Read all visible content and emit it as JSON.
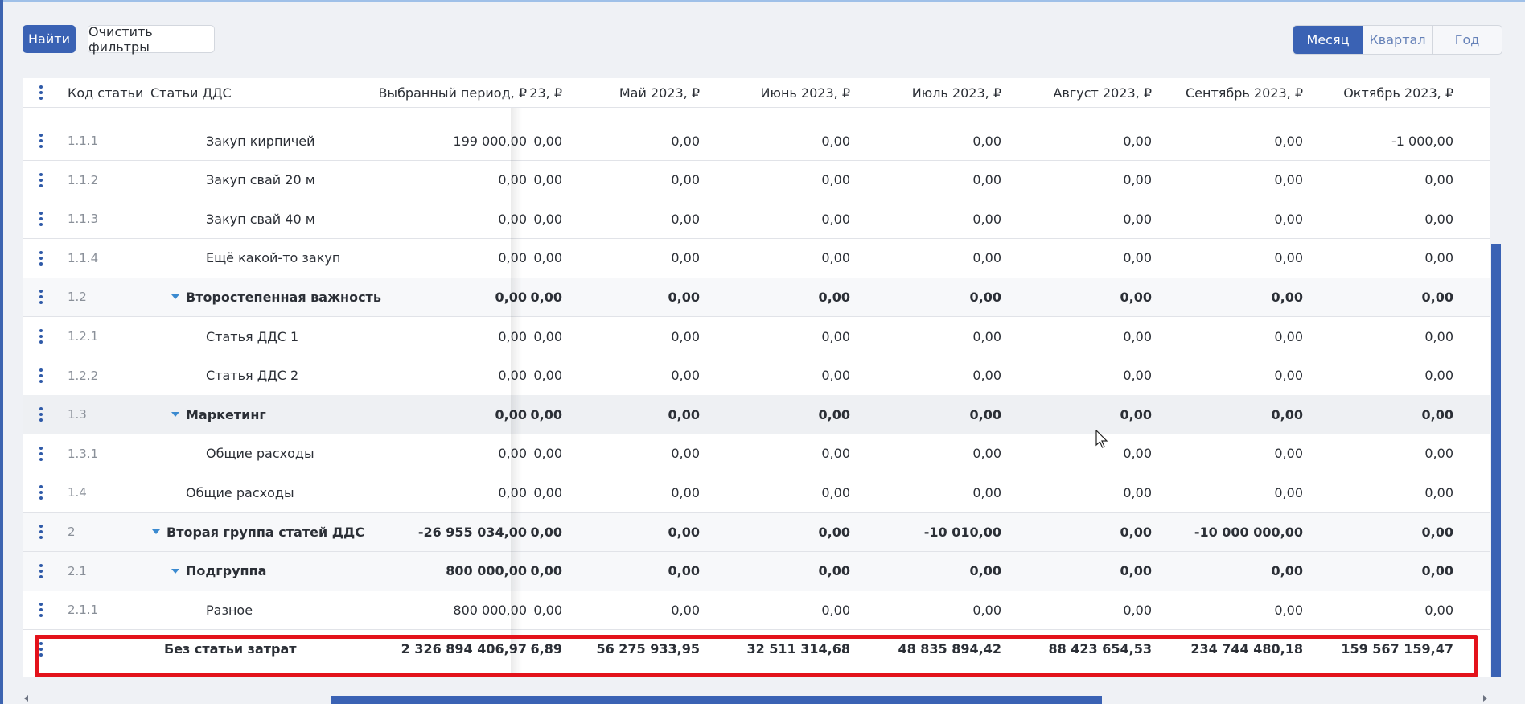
{
  "toolbar": {
    "find_label": "Найти",
    "clear_filters_label": "Очистить фильтры",
    "periods": [
      "Месяц",
      "Квартал",
      "Год"
    ],
    "active_period": "Месяц"
  },
  "table": {
    "headers": {
      "code": "Код статьи",
      "name": "Статьи ДДС",
      "selected": "Выбранный период, ₽",
      "partial": "23, ₽",
      "months": [
        "Май 2023, ₽",
        "Июнь 2023, ₽",
        "Июль 2023, ₽",
        "Август 2023, ₽",
        "Сентябрь 2023, ₽",
        "Октябрь 2023, ₽"
      ]
    },
    "rows": [
      {
        "code": "1.1.1",
        "name": "Закуп кирпичей",
        "level": 2,
        "group": false,
        "sel": "199 000,00",
        "p": "0,00",
        "m": [
          "0,00",
          "0,00",
          "0,00",
          "0,00",
          "0,00",
          "-1 000,00"
        ]
      },
      {
        "code": "1.1.2",
        "name": "Закуп свай 20 м",
        "level": 2,
        "group": false,
        "sel": "0,00",
        "p": "0,00",
        "m": [
          "0,00",
          "0,00",
          "0,00",
          "0,00",
          "0,00",
          "0,00"
        ]
      },
      {
        "code": "1.1.3",
        "name": "Закуп свай 40 м",
        "level": 2,
        "group": false,
        "sel": "0,00",
        "p": "0,00",
        "m": [
          "0,00",
          "0,00",
          "0,00",
          "0,00",
          "0,00",
          "0,00"
        ]
      },
      {
        "code": "1.1.4",
        "name": "Ещё какой-то закуп",
        "level": 2,
        "group": false,
        "sel": "0,00",
        "p": "0,00",
        "m": [
          "0,00",
          "0,00",
          "0,00",
          "0,00",
          "0,00",
          "0,00"
        ]
      },
      {
        "code": "1.2",
        "name": "Второстепенная важность",
        "level": 1,
        "group": true,
        "sel": "0,00",
        "p": "0,00",
        "m": [
          "0,00",
          "0,00",
          "0,00",
          "0,00",
          "0,00",
          "0,00"
        ]
      },
      {
        "code": "1.2.1",
        "name": "Статья ДДС 1",
        "level": 2,
        "group": false,
        "sel": "0,00",
        "p": "0,00",
        "m": [
          "0,00",
          "0,00",
          "0,00",
          "0,00",
          "0,00",
          "0,00"
        ]
      },
      {
        "code": "1.2.2",
        "name": "Статья ДДС 2",
        "level": 2,
        "group": false,
        "sel": "0,00",
        "p": "0,00",
        "m": [
          "0,00",
          "0,00",
          "0,00",
          "0,00",
          "0,00",
          "0,00"
        ]
      },
      {
        "code": "1.3",
        "name": "Маркетинг",
        "level": 1,
        "group": true,
        "shaded": true,
        "sel": "0,00",
        "p": "0,00",
        "m": [
          "0,00",
          "0,00",
          "0,00",
          "0,00",
          "0,00",
          "0,00"
        ]
      },
      {
        "code": "1.3.1",
        "name": "Общие расходы",
        "level": 2,
        "group": false,
        "sel": "0,00",
        "p": "0,00",
        "m": [
          "0,00",
          "0,00",
          "0,00",
          "0,00",
          "0,00",
          "0,00"
        ]
      },
      {
        "code": "1.4",
        "name": "Общие расходы",
        "level": 1,
        "group": false,
        "nocaret": true,
        "sel": "0,00",
        "p": "0,00",
        "m": [
          "0,00",
          "0,00",
          "0,00",
          "0,00",
          "0,00",
          "0,00"
        ]
      },
      {
        "code": "2",
        "name": "Вторая группа статей ДДС",
        "level": 0,
        "group": true,
        "sel": "-26 955 034,00",
        "p": "0,00",
        "m": [
          "0,00",
          "0,00",
          "-10 010,00",
          "0,00",
          "-10 000 000,00",
          "0,00"
        ]
      },
      {
        "code": "2.1",
        "name": "Подгруппа",
        "level": 1,
        "group": true,
        "sel": "800 000,00",
        "p": "0,00",
        "m": [
          "0,00",
          "0,00",
          "0,00",
          "0,00",
          "0,00",
          "0,00"
        ]
      },
      {
        "code": "2.1.1",
        "name": "Разное",
        "level": 2,
        "group": false,
        "sel": "800 000,00",
        "p": "0,00",
        "m": [
          "0,00",
          "0,00",
          "0,00",
          "0,00",
          "0,00",
          "0,00"
        ]
      }
    ],
    "total": {
      "name": "Без статьи затрат",
      "sel": "2 326 894 406,97",
      "p": "6,89",
      "m": [
        "56 275 933,95",
        "32 511 314,68",
        "48 835 894,42",
        "88 423 654,53",
        "234 744 480,18",
        "159 567 159,47"
      ]
    }
  }
}
